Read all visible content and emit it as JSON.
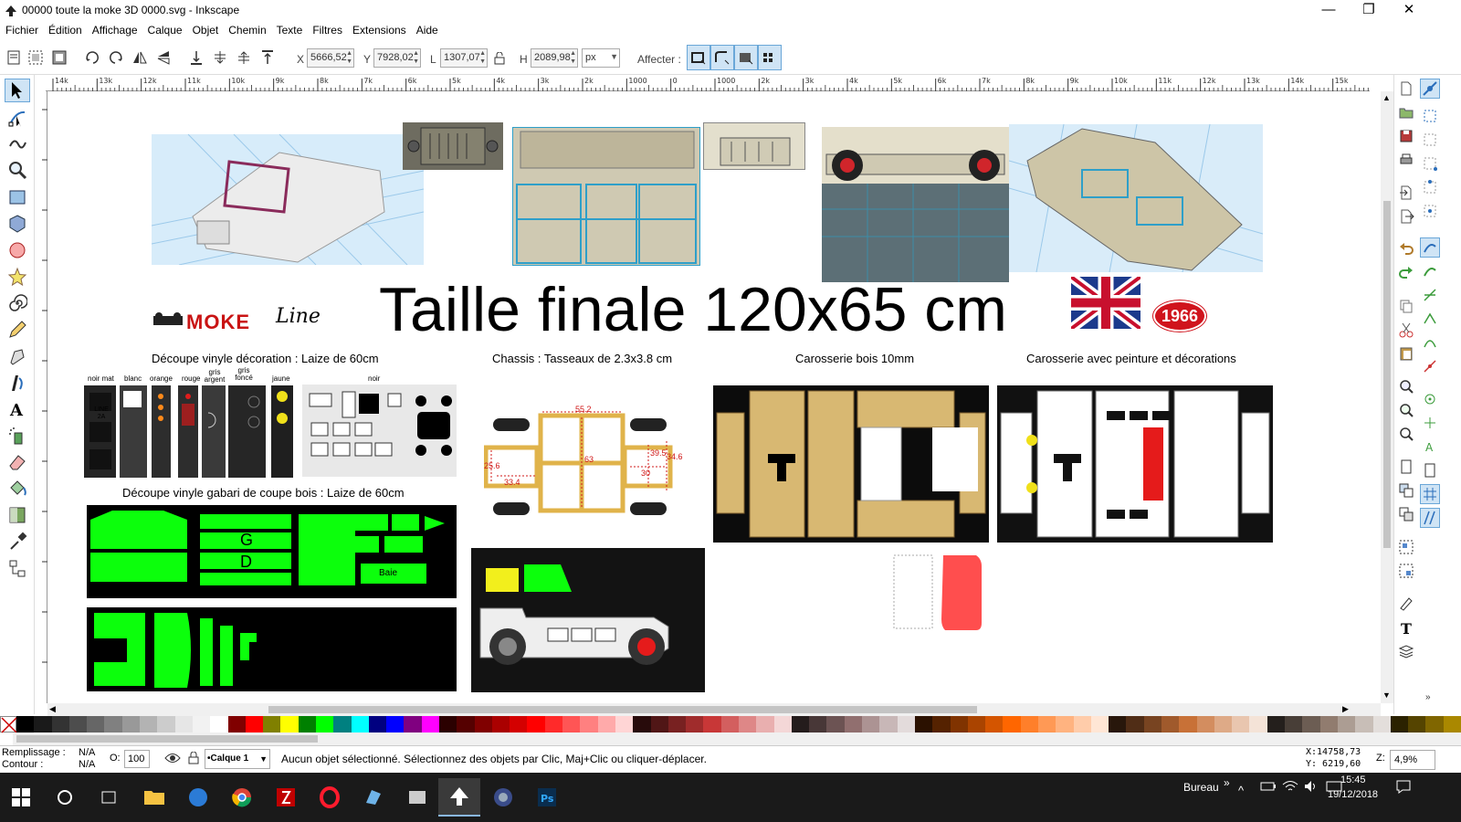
{
  "window": {
    "title": "00000 toute la moke 3D      0000.svg - Inkscape",
    "minimize": "—",
    "maximize": "❐",
    "close": "✕"
  },
  "menu": [
    "Fichier",
    "Édition",
    "Affichage",
    "Calque",
    "Objet",
    "Chemin",
    "Texte",
    "Filtres",
    "Extensions",
    "Aide"
  ],
  "controls": {
    "x_label": "X",
    "x_value": "5666,52",
    "y_label": "Y",
    "y_value": "7928,02",
    "w_label": "L",
    "w_value": "1307,07",
    "h_label": "H",
    "h_value": "2089,98",
    "unit": "px",
    "affecter_label": "Affecter :"
  },
  "ruler": {
    "ticks": [
      "14k",
      "13k",
      "12k",
      "11k",
      "10k",
      "9k",
      "8k",
      "7k",
      "6k",
      "5k",
      "4k",
      "3k",
      "2k",
      "1000",
      "0",
      "1000",
      "2k",
      "3k",
      "4k",
      "5k",
      "6k",
      "7k",
      "8k",
      "9k",
      "10k",
      "11k",
      "12k",
      "13k",
      "14k",
      "15k"
    ]
  },
  "canvas": {
    "title_main": "Taille finale 120x65 cm",
    "badge_1966": "1966",
    "logo_moke": "MOKE",
    "logo_line": "Line",
    "h_vinyle_deco": "Découpe vinyle décoration : Laize de 60cm",
    "h_chassis": "Chassis : Tasseaux de 2.3x3.8 cm",
    "h_bois": "Carosserie bois 10mm",
    "h_peinture": "Carosserie avec peinture et décorations",
    "h_gabari": "Découpe vinyle gabari de coupe bois : Laize de 60cm",
    "colors_labels": [
      "noir mat",
      "blanc",
      "orange",
      "rouge",
      "gris argent",
      "gris foncé",
      "jaune"
    ],
    "label_noir": "noir",
    "line2a": "LINE 2A",
    "gabari_letters": [
      "G",
      "D",
      "Baie"
    ],
    "chassis_dims": [
      "55.2",
      "25.6",
      "33.4",
      "63",
      "30",
      "39.5",
      "34.6"
    ]
  },
  "status": {
    "fill_label": "Remplissage :",
    "fill_value": "N/A",
    "stroke_label": "Contour :",
    "stroke_value": "N/A",
    "opacity_label": "O:",
    "opacity_value": "100",
    "layer": "•Calque 1",
    "message": "Aucun objet sélectionné. Sélectionnez des objets par Clic, Maj+Clic ou cliquer-déplacer.",
    "cursor_x": "X:14758,73",
    "cursor_y": "Y:  6219,60",
    "zoom_label": "Z:",
    "zoom_value": "4,9%"
  },
  "taskbar": {
    "bureau": "Bureau",
    "time": "15:45",
    "date": "19/12/2018"
  },
  "palette_colors": [
    "#000000",
    "#1a1a1a",
    "#333333",
    "#4d4d4d",
    "#666666",
    "#808080",
    "#999999",
    "#b3b3b3",
    "#cccccc",
    "#e6e6e6",
    "#f2f2f2",
    "#ffffff",
    "#800000",
    "#ff0000",
    "#808000",
    "#ffff00",
    "#008000",
    "#00ff00",
    "#008080",
    "#00ffff",
    "#000080",
    "#0000ff",
    "#800080",
    "#ff00ff",
    "#2b0000",
    "#550000",
    "#800000",
    "#aa0000",
    "#d40000",
    "#ff0000",
    "#ff2a2a",
    "#ff5555",
    "#ff8080",
    "#ffaaaa",
    "#ffd5d5",
    "#280b0b",
    "#501616",
    "#782121",
    "#a02c2c",
    "#c83737",
    "#d35f5f",
    "#de8787",
    "#e9afaf",
    "#f4d7d7",
    "#241c1c",
    "#483737",
    "#6c5353",
    "#916f6f",
    "#ac9393",
    "#c8b7b7",
    "#e3dbdb",
    "#2b1100",
    "#552200",
    "#803300",
    "#aa4400",
    "#d45500",
    "#ff6600",
    "#ff7f2a",
    "#ff9955",
    "#ffb380",
    "#ffccaa",
    "#ffe6d5",
    "#28170b",
    "#502d16",
    "#784421",
    "#a05a2c",
    "#c87137",
    "#d38d5f",
    "#deaa87",
    "#e9c6af",
    "#f4e3d7",
    "#241f1c",
    "#483e37",
    "#6c5d53",
    "#917c6f",
    "#ac9d93",
    "#c8beb7",
    "#e3dedb",
    "#2b2200",
    "#554400",
    "#806600",
    "#aa8800"
  ]
}
